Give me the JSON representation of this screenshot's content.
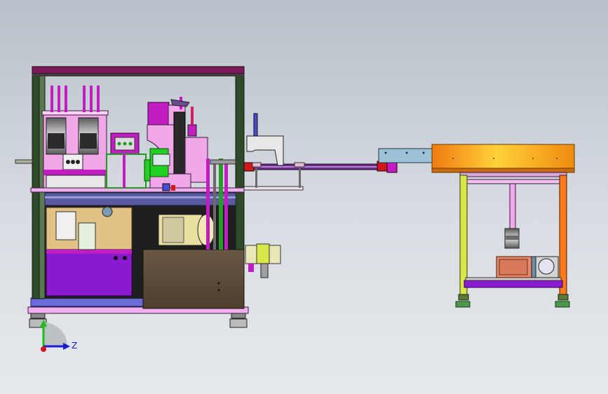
{
  "viewport": {
    "background": "#c9ced5"
  },
  "triad": {
    "axis_label": "Z",
    "colors": {
      "x": "#1a1ad0",
      "y": "#18c018",
      "z": "#d01818"
    }
  },
  "colors": {
    "frame_green": "#2f4a2a",
    "magenta": "#c21cc2",
    "purple": "#8a1ad0",
    "pink": "#f0a8e8",
    "dark_brown": "#5b4a38",
    "tan": "#e2c184",
    "yellow_green": "#d8e84a",
    "orange_top": "#f08a10",
    "orange_leg": "#ff7a1a",
    "motor_salmon": "#e88a6a",
    "gray_blue": "#6f8fa3",
    "light_gray": "#d4d4d4"
  }
}
